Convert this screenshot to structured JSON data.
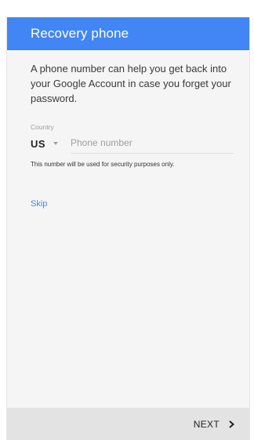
{
  "header": {
    "title": "Recovery phone"
  },
  "main": {
    "intro": "A phone number can help you get back into your Google Account in case you forget your password.",
    "country_label": "Country",
    "country_code": "US",
    "phone_placeholder": "Phone number",
    "phone_value": "",
    "note": "This number will be used for security purposes only.",
    "skip_label": "Skip"
  },
  "footer": {
    "next_label": "NEXT"
  },
  "colors": {
    "accent": "#4285f4",
    "footer_bg": "#e3e3e3",
    "body_bg": "#f5f5f5"
  },
  "icons": {
    "country_dropdown": "caret-down-icon",
    "next": "chevron-right-icon"
  }
}
